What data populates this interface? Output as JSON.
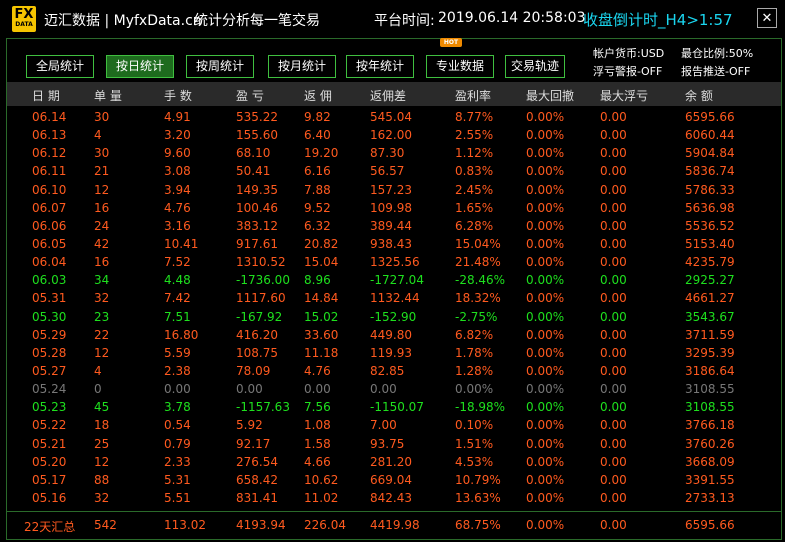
{
  "header": {
    "logo_top": "FX",
    "logo_bottom": "DATA",
    "app_title": "迈汇数据 | MyfxData.cn",
    "subtitle": "统计分析每一笔交易",
    "time_label": "平台时间:",
    "time_value": "2019.06.14 20:58:03",
    "countdown": "收盘倒计时_H4>1:57",
    "close_glyph": "✕"
  },
  "tabs": [
    {
      "label": "全局统计",
      "active": false
    },
    {
      "label": "按日统计",
      "active": true
    },
    {
      "label": "按周统计",
      "active": false
    },
    {
      "label": "按月统计",
      "active": false
    },
    {
      "label": "按年统计",
      "active": false
    },
    {
      "label": "专业数据",
      "active": false
    },
    {
      "label": "交易轨迹",
      "active": false
    }
  ],
  "hot_badge": "HOT",
  "info": {
    "currency": "帐户货币:USD",
    "position_ratio": "最仓比例:50%",
    "float_alert": "浮亏警报-OFF",
    "report_push": "报告推送-OFF"
  },
  "columns": [
    "日 期",
    "单 量",
    "手 数",
    "盈 亏",
    "返 佣",
    "返佣差",
    "盈利率",
    "最大回撤",
    "最大浮亏",
    "余 额"
  ],
  "rows": [
    {
      "status": "profit",
      "cells": [
        "06.14",
        "30",
        "4.91",
        "535.22",
        "9.82",
        "545.04",
        "8.77%",
        "0.00%",
        "0.00",
        "6595.66"
      ]
    },
    {
      "status": "profit",
      "cells": [
        "06.13",
        "4",
        "3.20",
        "155.60",
        "6.40",
        "162.00",
        "2.55%",
        "0.00%",
        "0.00",
        "6060.44"
      ]
    },
    {
      "status": "profit",
      "cells": [
        "06.12",
        "30",
        "9.60",
        "68.10",
        "19.20",
        "87.30",
        "1.12%",
        "0.00%",
        "0.00",
        "5904.84"
      ]
    },
    {
      "status": "profit",
      "cells": [
        "06.11",
        "21",
        "3.08",
        "50.41",
        "6.16",
        "56.57",
        "0.83%",
        "0.00%",
        "0.00",
        "5836.74"
      ]
    },
    {
      "status": "profit",
      "cells": [
        "06.10",
        "12",
        "3.94",
        "149.35",
        "7.88",
        "157.23",
        "2.45%",
        "0.00%",
        "0.00",
        "5786.33"
      ]
    },
    {
      "status": "profit",
      "cells": [
        "06.07",
        "16",
        "4.76",
        "100.46",
        "9.52",
        "109.98",
        "1.65%",
        "0.00%",
        "0.00",
        "5636.98"
      ]
    },
    {
      "status": "profit",
      "cells": [
        "06.06",
        "24",
        "3.16",
        "383.12",
        "6.32",
        "389.44",
        "6.28%",
        "0.00%",
        "0.00",
        "5536.52"
      ]
    },
    {
      "status": "profit",
      "cells": [
        "06.05",
        "42",
        "10.41",
        "917.61",
        "20.82",
        "938.43",
        "15.04%",
        "0.00%",
        "0.00",
        "5153.40"
      ]
    },
    {
      "status": "profit",
      "cells": [
        "06.04",
        "16",
        "7.52",
        "1310.52",
        "15.04",
        "1325.56",
        "21.48%",
        "0.00%",
        "0.00",
        "4235.79"
      ]
    },
    {
      "status": "loss",
      "cells": [
        "06.03",
        "34",
        "4.48",
        "-1736.00",
        "8.96",
        "-1727.04",
        "-28.46%",
        "0.00%",
        "0.00",
        "2925.27"
      ]
    },
    {
      "status": "profit",
      "cells": [
        "05.31",
        "32",
        "7.42",
        "1117.60",
        "14.84",
        "1132.44",
        "18.32%",
        "0.00%",
        "0.00",
        "4661.27"
      ]
    },
    {
      "status": "loss",
      "cells": [
        "05.30",
        "23",
        "7.51",
        "-167.92",
        "15.02",
        "-152.90",
        "-2.75%",
        "0.00%",
        "0.00",
        "3543.67"
      ]
    },
    {
      "status": "profit",
      "cells": [
        "05.29",
        "22",
        "16.80",
        "416.20",
        "33.60",
        "449.80",
        "6.82%",
        "0.00%",
        "0.00",
        "3711.59"
      ]
    },
    {
      "status": "profit",
      "cells": [
        "05.28",
        "12",
        "5.59",
        "108.75",
        "11.18",
        "119.93",
        "1.78%",
        "0.00%",
        "0.00",
        "3295.39"
      ]
    },
    {
      "status": "profit",
      "cells": [
        "05.27",
        "4",
        "2.38",
        "78.09",
        "4.76",
        "82.85",
        "1.28%",
        "0.00%",
        "0.00",
        "3186.64"
      ]
    },
    {
      "status": "none",
      "cells": [
        "05.24",
        "0",
        "0.00",
        "0.00",
        "0.00",
        "0.00",
        "0.00%",
        "0.00%",
        "0.00",
        "3108.55"
      ]
    },
    {
      "status": "loss",
      "cells": [
        "05.23",
        "45",
        "3.78",
        "-1157.63",
        "7.56",
        "-1150.07",
        "-18.98%",
        "0.00%",
        "0.00",
        "3108.55"
      ]
    },
    {
      "status": "profit",
      "cells": [
        "05.22",
        "18",
        "0.54",
        "5.92",
        "1.08",
        "7.00",
        "0.10%",
        "0.00%",
        "0.00",
        "3766.18"
      ]
    },
    {
      "status": "profit",
      "cells": [
        "05.21",
        "25",
        "0.79",
        "92.17",
        "1.58",
        "93.75",
        "1.51%",
        "0.00%",
        "0.00",
        "3760.26"
      ]
    },
    {
      "status": "profit",
      "cells": [
        "05.20",
        "12",
        "2.33",
        "276.54",
        "4.66",
        "281.20",
        "4.53%",
        "0.00%",
        "0.00",
        "3668.09"
      ]
    },
    {
      "status": "profit",
      "cells": [
        "05.17",
        "88",
        "5.31",
        "658.42",
        "10.62",
        "669.04",
        "10.79%",
        "0.00%",
        "0.00",
        "3391.55"
      ]
    },
    {
      "status": "profit",
      "cells": [
        "05.16",
        "32",
        "5.51",
        "831.41",
        "11.02",
        "842.43",
        "13.63%",
        "0.00%",
        "0.00",
        "2733.13"
      ]
    }
  ],
  "totals": [
    "22天汇总",
    "542",
    "113.02",
    "4193.94",
    "226.04",
    "4419.98",
    "68.75%",
    "0.00%",
    "0.00",
    "6595.66"
  ],
  "colors": {
    "profit": "#ff5a1f",
    "loss": "#1ee01e",
    "none": "#777777",
    "accent": "#1ad6f0",
    "tab_border": "#3fbf3f"
  }
}
